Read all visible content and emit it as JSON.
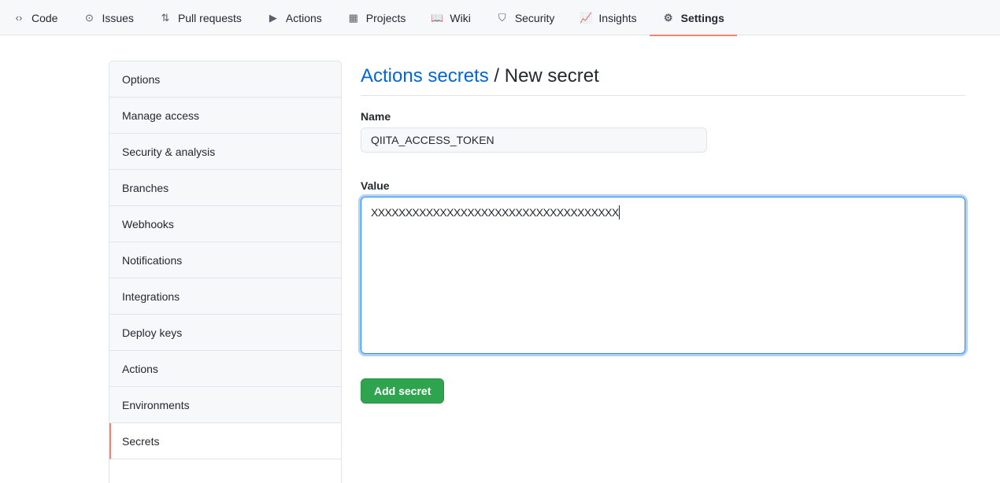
{
  "nav": [
    {
      "label": "Code",
      "icon": "code-icon",
      "glyph": "‹›"
    },
    {
      "label": "Issues",
      "icon": "issue-icon",
      "glyph": "⊙"
    },
    {
      "label": "Pull requests",
      "icon": "pull-request-icon",
      "glyph": "⇅"
    },
    {
      "label": "Actions",
      "icon": "play-icon",
      "glyph": "▶"
    },
    {
      "label": "Projects",
      "icon": "project-icon",
      "glyph": "▦"
    },
    {
      "label": "Wiki",
      "icon": "book-icon",
      "glyph": "📖"
    },
    {
      "label": "Security",
      "icon": "shield-icon",
      "glyph": "⛉"
    },
    {
      "label": "Insights",
      "icon": "graph-icon",
      "glyph": "📈"
    },
    {
      "label": "Settings",
      "icon": "gear-icon",
      "glyph": "⚙"
    }
  ],
  "sidebar": [
    "Options",
    "Manage access",
    "Security & analysis",
    "Branches",
    "Webhooks",
    "Notifications",
    "Integrations",
    "Deploy keys",
    "Actions",
    "Environments",
    "Secrets"
  ],
  "header": {
    "link": "Actions secrets",
    "sep": " / ",
    "title": "New secret"
  },
  "form": {
    "name_label": "Name",
    "name_value": "QIITA_ACCESS_TOKEN",
    "value_label": "Value",
    "value_value": "XXXXXXXXXXXXXXXXXXXXXXXXXXXXXXXXXXXX",
    "submit": "Add secret"
  }
}
